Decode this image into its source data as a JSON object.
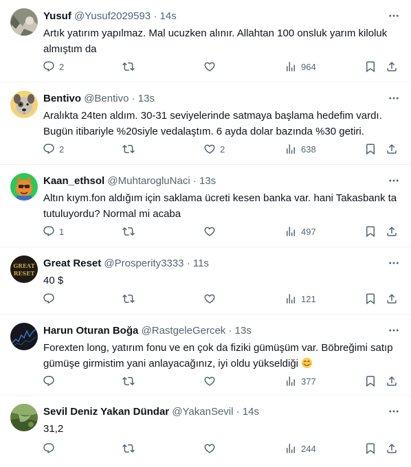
{
  "tweets": [
    {
      "name": "Yusuf",
      "handle": "@Yusuf2029593",
      "time": "14s",
      "text": "Artık yatırım yapılmaz. Mal ucuzken alınır. Allahtan 100 onsluk yarım kiloluk almıştım da",
      "replies": "2",
      "retweets": "",
      "likes": "",
      "views": "964"
    },
    {
      "name": "Bentivo",
      "handle": "@Bentivo",
      "time": "13s",
      "text": "Aralıkta 24ten aldım. 30-31 seviyelerinde satmaya başlama hedefim vardı. Bugün itibariyle %20siyle vedalaştım. 6 ayda dolar bazında %30 getiri.",
      "replies": "2",
      "retweets": "",
      "likes": "2",
      "views": "638"
    },
    {
      "name": "Kaan_ethsol",
      "handle": "@MuhtarogluNaci",
      "time": "13s",
      "text": "Altın kıym.fon aldığım için saklama ücreti kesen banka var. hani Takasbank ta tutuluyordu? Normal mi acaba",
      "replies": "1",
      "retweets": "",
      "likes": "",
      "views": "497"
    },
    {
      "name": "Great Reset",
      "handle": "@Prosperity3333",
      "time": "11s",
      "text": "40 $",
      "replies": "",
      "retweets": "",
      "likes": "",
      "views": "121",
      "avatar_text": [
        "GREAT",
        "RESET"
      ]
    },
    {
      "name": "Harun Oturan Boğa",
      "handle": "@RastgeleGercek",
      "time": "13s",
      "text": "Forexten long, yatırım fonu ve en çok da fiziki gümüşüm var. Böbreğimi satıp gümüşe girmistim yani anlayacağınız, iyi oldu yükseldiği",
      "emoji": "smiling-face-emoji",
      "replies": "",
      "retweets": "",
      "likes": "",
      "views": "377"
    },
    {
      "name": "Sevil Deniz Yakan Dündar",
      "handle": "@YakanSevil",
      "time": "14s",
      "text": "31,2",
      "replies": "",
      "retweets": "",
      "likes": "",
      "views": "244"
    }
  ],
  "separator": "·",
  "icons": {
    "more": "more-horizontal-icon",
    "reply": "reply-icon",
    "retweet": "retweet-icon",
    "like": "heart-icon",
    "views": "views-icon",
    "bookmark": "bookmark-icon",
    "share": "share-icon"
  },
  "colors": {
    "text": "#0f1419",
    "secondary": "#536471",
    "border": "#eff3f4"
  }
}
